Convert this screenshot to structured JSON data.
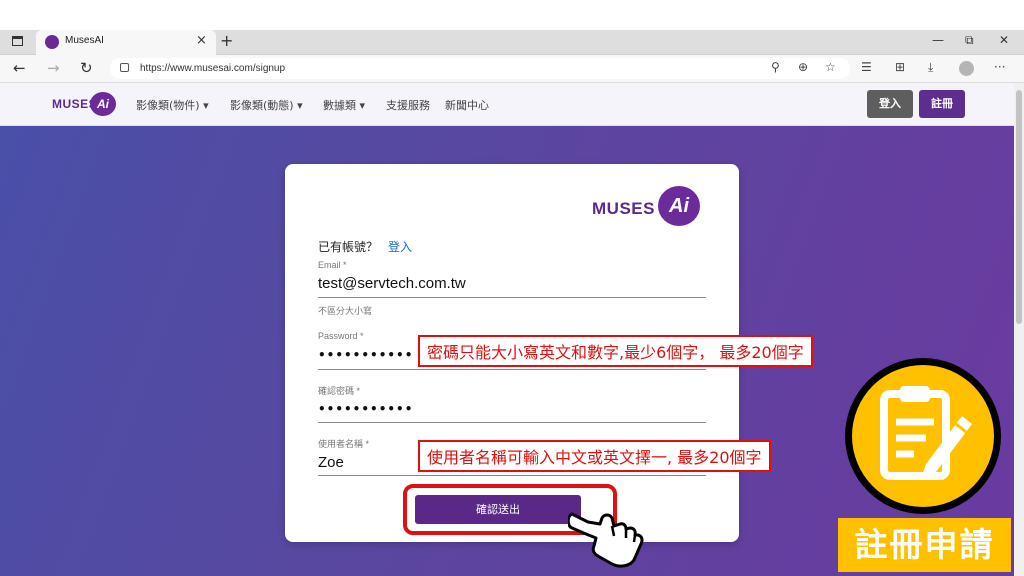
{
  "browser": {
    "tab_title": "MusesAI",
    "tab_close": "×",
    "new_tab": "+",
    "url": "https://www.musesai.com/signup",
    "win_min": "—",
    "win_restore": "⧉",
    "win_close": "✕",
    "more": "···",
    "back": "←",
    "forward": "→",
    "reload": "↻"
  },
  "site": {
    "logo_text": "MUSES",
    "logo_ai": "Ai",
    "menu": [
      "影像類(物件) ▾",
      "影像類(動態) ▾",
      "數據類 ▾",
      "支援服務",
      "新聞中心"
    ],
    "login_button": "登入",
    "register_button": "註冊"
  },
  "form": {
    "logo_text": "MUSES",
    "logo_ai": "Ai",
    "have_account": "已有帳號？",
    "login_link": "登入",
    "email_label": "Email *",
    "email_value": "test@servtech.com.tw",
    "email_hint": "不區分大小寫",
    "password_label": "Password *",
    "password_value": "•••••••••••",
    "confirm_label": "確認密碼 *",
    "confirm_value": "•••••••••••",
    "username_label": "使用者名稱 *",
    "username_value": "Zoe",
    "submit": "確認送出"
  },
  "annotations": {
    "password_note": "密碼只能大小寫英文和數字,最少6個字， 最多20個字",
    "username_note": "使用者名稱可輸入中文或英文擇一, 最多20個字",
    "badge_label": "註冊申請",
    "accent_color": "#e01010",
    "badge_color": "#ffc000"
  }
}
